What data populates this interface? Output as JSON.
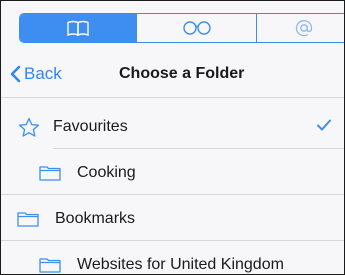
{
  "segmented_control": {
    "items": [
      {
        "icon": "book-icon",
        "selected": true
      },
      {
        "icon": "reading-glasses-icon",
        "selected": false
      },
      {
        "icon": "at-sign-icon",
        "selected": false
      }
    ]
  },
  "navbar": {
    "back_label": "Back",
    "title": "Choose a Folder"
  },
  "folders": [
    {
      "label": "Favourites",
      "icon": "star-icon",
      "selected": true
    },
    {
      "label": "Cooking",
      "icon": "folder-icon",
      "selected": false
    },
    {
      "label": "Bookmarks",
      "icon": "folder-icon",
      "selected": false
    },
    {
      "label": "Websites for United Kingdom",
      "icon": "folder-icon",
      "selected": false
    }
  ],
  "colors": {
    "accent": "#3d8ef0",
    "background": "#f7f7f9",
    "separator": "#d7d7db"
  }
}
